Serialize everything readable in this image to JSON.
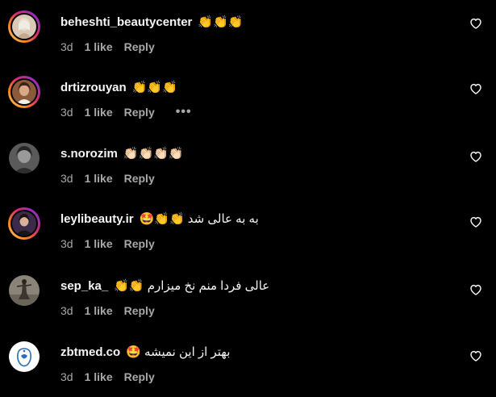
{
  "colors": {
    "background": "#000000",
    "primary_text": "#f5f5f5",
    "secondary_text": "#a8a8a8",
    "story_ring": [
      "#feda75",
      "#fa7e1e",
      "#d62976",
      "#962fbf",
      "#4f5bd5"
    ]
  },
  "comments": [
    {
      "username": "beheshti_beautycenter",
      "text": "👏👏👏",
      "time": "3d",
      "likes": "1 like",
      "reply": "Reply",
      "avatar_icon": "profile-photo",
      "has_story_ring": true
    },
    {
      "username": "drtizrouyan",
      "text": "👏👏👏",
      "time": "3d",
      "likes": "1 like",
      "reply": "Reply",
      "more": "•••",
      "avatar_icon": "profile-photo",
      "has_story_ring": true
    },
    {
      "username": "s.norozim",
      "text": "👏🏻👏🏻👏🏻👏🏻",
      "time": "3d",
      "likes": "1 like",
      "reply": "Reply",
      "avatar_icon": "profile-photo",
      "has_story_ring": false
    },
    {
      "username": "leylibeauty.ir",
      "text": "به به عالی شد 👏👏🤩",
      "time": "3d",
      "likes": "1 like",
      "reply": "Reply",
      "avatar_icon": "profile-photo",
      "has_story_ring": true
    },
    {
      "username": "sep_ka_",
      "text": "عالی فردا منم نخ میزارم 👏👏",
      "time": "3d",
      "likes": "1 like",
      "reply": "Reply",
      "avatar_icon": "profile-photo",
      "has_story_ring": false
    },
    {
      "username": "zbtmed.co",
      "text": "بهتر از این نمیشه 🤩",
      "time": "3d",
      "likes": "1 like",
      "reply": "Reply",
      "avatar_icon": "logo",
      "has_story_ring": false
    }
  ],
  "like_icon": "heart-outline-icon"
}
